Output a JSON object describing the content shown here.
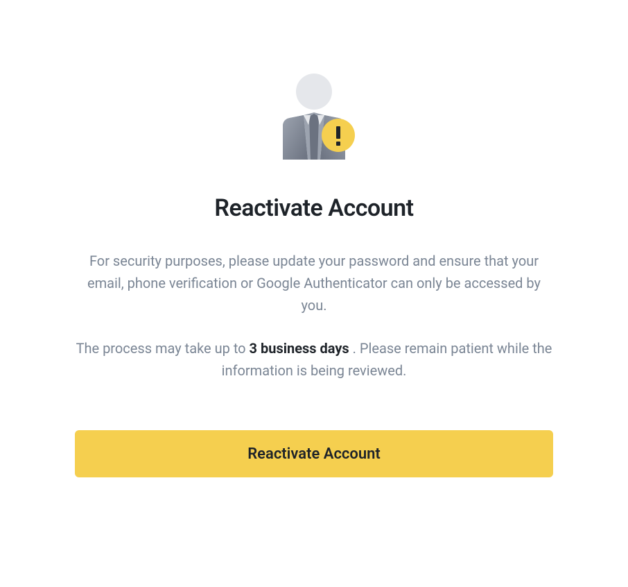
{
  "title": "Reactivate Account",
  "description1": "For security purposes, please update your password and ensure that your email, phone verification or Google Authenticator can only be accessed by you.",
  "description2_prefix": "The process may take up to ",
  "description2_bold": "3 business days",
  "description2_suffix": " . Please remain patient while the information is being reviewed.",
  "button_label": "Reactivate Account",
  "colors": {
    "accent": "#f5cf4f",
    "text_primary": "#1e2329",
    "text_secondary": "#7a8594"
  }
}
